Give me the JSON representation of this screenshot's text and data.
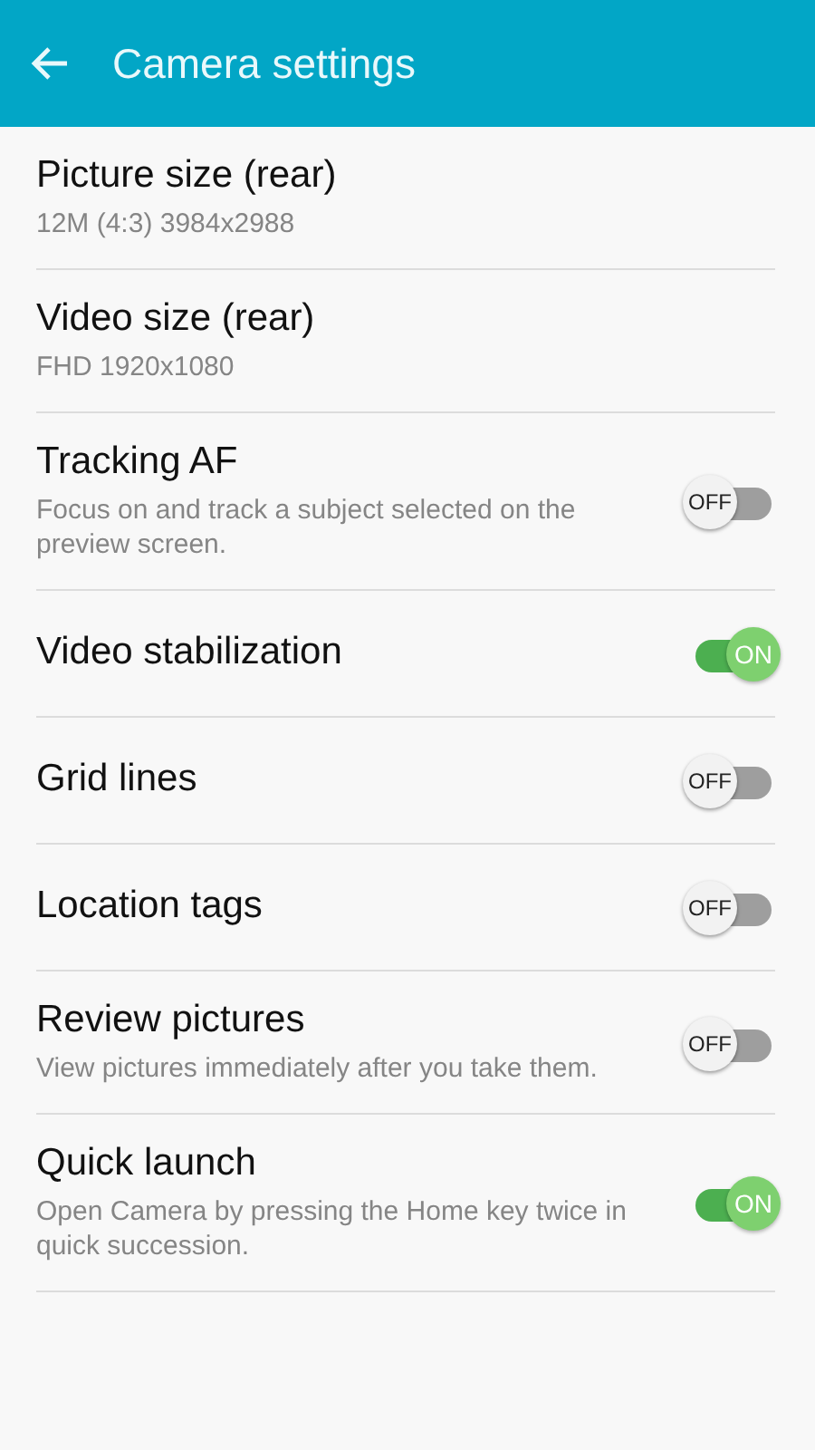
{
  "app_bar": {
    "title": "Camera settings"
  },
  "settings": [
    {
      "kind": "value",
      "title": "Picture size (rear)",
      "summary": "12M (4:3) 3984x2988"
    },
    {
      "kind": "value",
      "title": "Video size (rear)",
      "summary": "FHD 1920x1080"
    },
    {
      "kind": "switch",
      "title": "Tracking AF",
      "summary": "Focus on and track a subject selected on the preview screen.",
      "on": false,
      "switch_label": "OFF"
    },
    {
      "kind": "switch",
      "title": "Video stabilization",
      "on": true,
      "switch_label": "ON"
    },
    {
      "kind": "switch",
      "title": "Grid lines",
      "on": false,
      "switch_label": "OFF"
    },
    {
      "kind": "switch",
      "title": "Location tags",
      "on": false,
      "switch_label": "OFF"
    },
    {
      "kind": "switch",
      "title": "Review pictures",
      "summary": "View pictures immediately after you take them.",
      "on": false,
      "switch_label": "OFF"
    },
    {
      "kind": "switch",
      "title": "Quick launch",
      "summary": "Open Camera by pressing the Home key twice in quick succession.",
      "on": true,
      "switch_label": "ON"
    }
  ]
}
